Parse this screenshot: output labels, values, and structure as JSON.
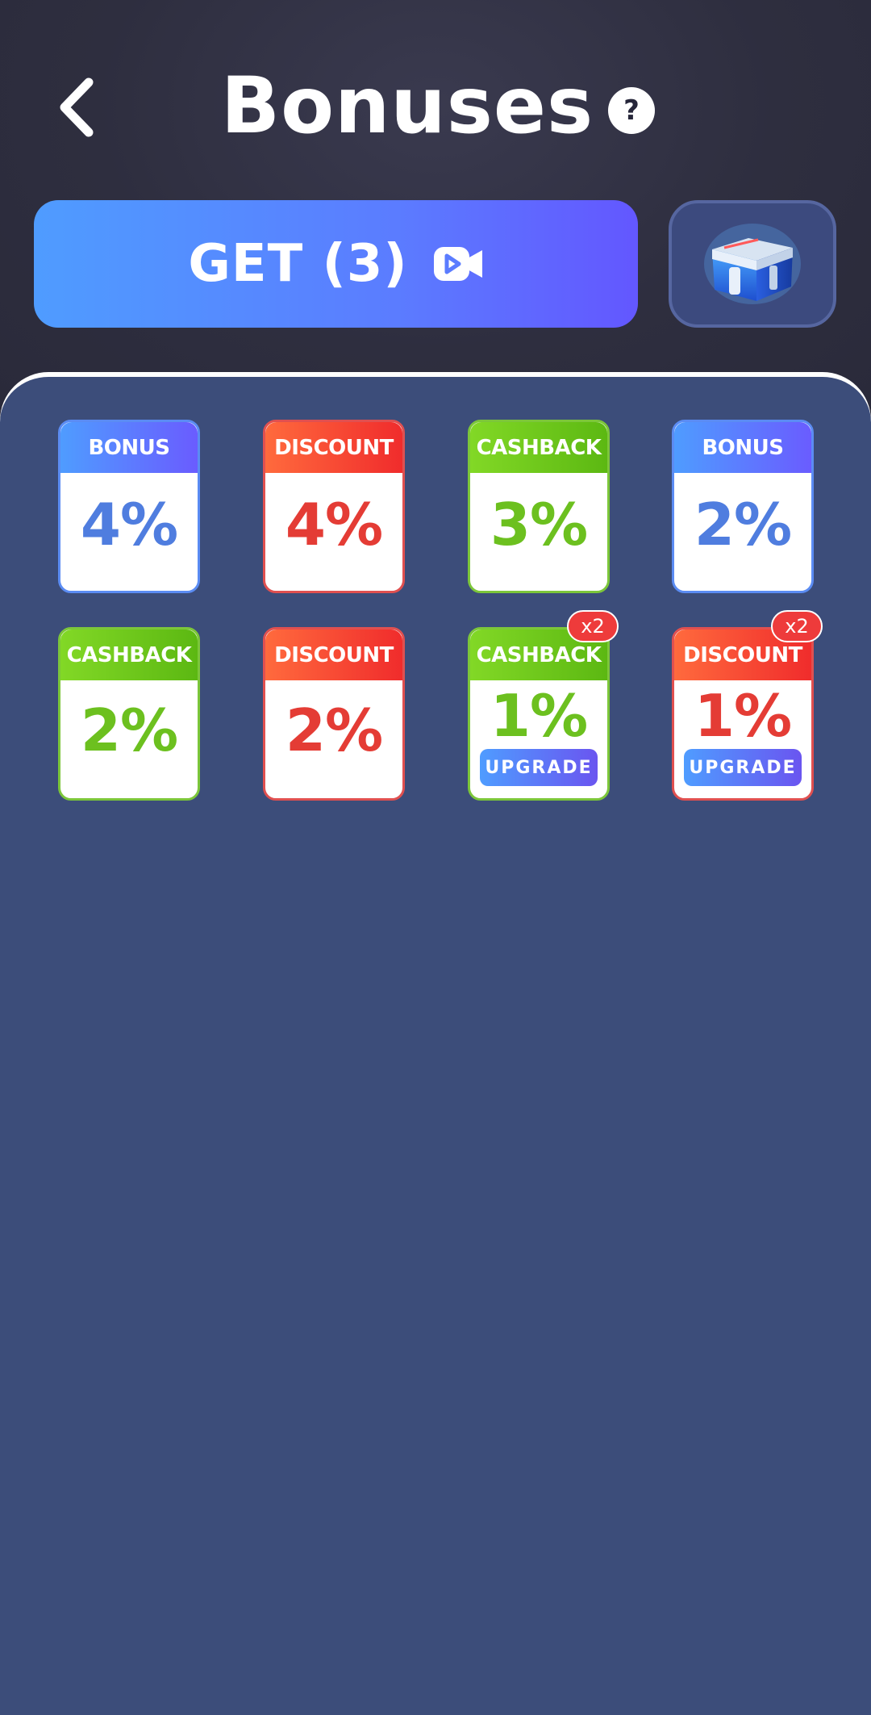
{
  "header": {
    "title": "Bonuses",
    "back_icon": "chevron-left-icon",
    "help_label": "?"
  },
  "get_button": {
    "label": "GET (3)",
    "icon": "video-play-icon"
  },
  "chest_button": {
    "icon": "treasure-chest-icon"
  },
  "cards": [
    {
      "type": "BONUS",
      "value": "4%"
    },
    {
      "type": "DISCOUNT",
      "value": "4%"
    },
    {
      "type": "CASHBACK",
      "value": "3%"
    },
    {
      "type": "BONUS",
      "value": "2%"
    },
    {
      "type": "CASHBACK",
      "value": "2%"
    },
    {
      "type": "DISCOUNT",
      "value": "2%"
    },
    {
      "type": "CASHBACK",
      "value": "1%",
      "badge": "x2",
      "action": "UPGRADE"
    },
    {
      "type": "DISCOUNT",
      "value": "1%",
      "badge": "x2",
      "action": "UPGRADE"
    }
  ],
  "colors": {
    "background": "#2f2f41",
    "panel": "#3c4d7a",
    "bonus": "#4f7ddf",
    "discount": "#e43c35",
    "cashback": "#6cc01f",
    "accent_gradient_start": "#4f9cff",
    "accent_gradient_end": "#6357ff"
  }
}
